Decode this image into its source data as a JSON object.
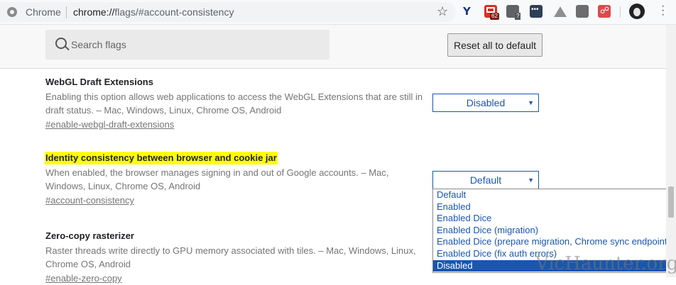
{
  "browser": {
    "site_name": "Chrome",
    "url_host": "chrome://",
    "url_path": "flags/#account-consistency",
    "extensions": {
      "mail_badge": "62",
      "grid_badge": "?"
    }
  },
  "search": {
    "placeholder": "Search flags"
  },
  "toolbar": {
    "reset_label": "Reset all to default"
  },
  "experiments": [
    {
      "title": "WebGL Draft Extensions",
      "description": "Enabling this option allows web applications to access the WebGL Extensions that are still in draft status. – Mac, Windows, Linux, Chrome OS, Android",
      "link": "#enable-webgl-draft-extensions",
      "selected": "Disabled"
    },
    {
      "title": "Identity consistency between browser and cookie jar",
      "description": "When enabled, the browser manages signing in and out of Google accounts. – Mac, Windows, Linux, Chrome OS, Android",
      "link": "#account-consistency",
      "selected": "Default",
      "highlighted": true
    },
    {
      "title": "Zero-copy rasterizer",
      "description": "Raster threads write directly to GPU memory associated with tiles. – Mac, Windows, Linux, Chrome OS, Android",
      "link": "#enable-zero-copy"
    }
  ],
  "dropdown": {
    "options": [
      "Default",
      "Enabled",
      "Enabled Dice",
      "Enabled Dice (migration)",
      "Enabled Dice (prepare migration, Chrome sync endpoint)",
      "Enabled Dice (fix auth errors)",
      "Disabled"
    ],
    "highlighted_option": "Disabled"
  },
  "watermark": "VicHaunter.org",
  "colors": {
    "accent": "#1a56b0",
    "highlight": "#ffff00",
    "muted_text": "#757575"
  }
}
